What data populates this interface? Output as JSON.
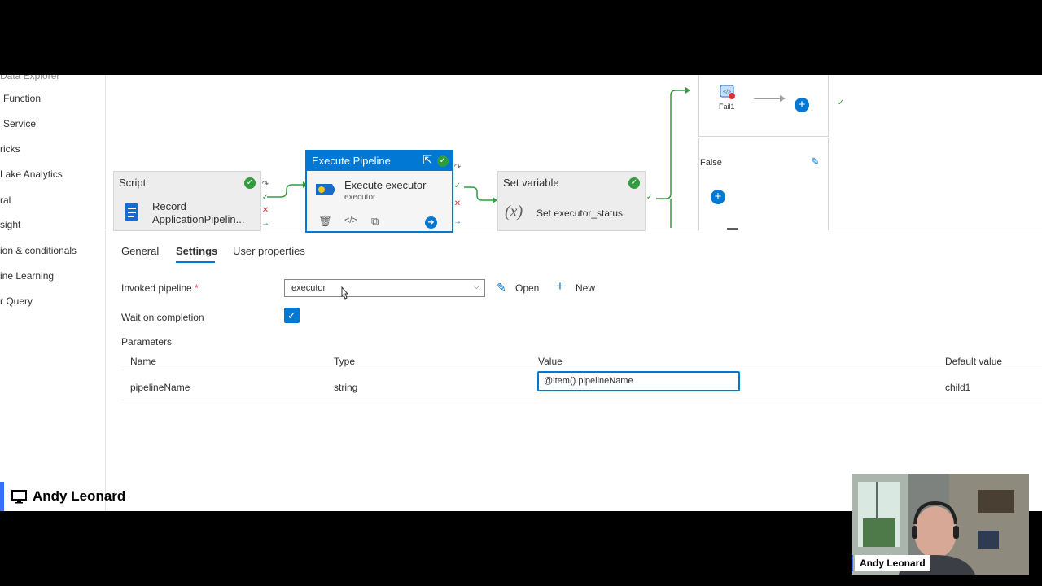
{
  "sidebar": {
    "items": [
      {
        "label": "Data Explorer"
      },
      {
        "label": "Function"
      },
      {
        "label": "Service"
      },
      {
        "label": "ricks"
      },
      {
        "label": "Lake Analytics"
      },
      {
        "label": "ral"
      },
      {
        "label": "sight"
      },
      {
        "label": "ion & conditionals"
      },
      {
        "label": "ine Learning"
      },
      {
        "label": "r Query"
      }
    ]
  },
  "canvas": {
    "script": {
      "header": "Script",
      "name_line1": "Record",
      "name_line2": "ApplicationPipelin..."
    },
    "execute_pipeline": {
      "header": "Execute Pipeline",
      "name": "Execute executor",
      "sub": "executor"
    },
    "set_variable": {
      "header": "Set variable",
      "symbol": "(x)",
      "name": "Set executor_status"
    },
    "fail": {
      "label": "Fail1"
    },
    "false_branch": {
      "label": "False"
    }
  },
  "tabs": [
    {
      "label": "General"
    },
    {
      "label": "Settings"
    },
    {
      "label": "User properties"
    }
  ],
  "settings": {
    "invoked_pipeline_label": "Invoked pipeline",
    "required_mark": "*",
    "invoked_pipeline_value": "executor",
    "open_label": "Open",
    "new_label": "New",
    "wait_label": "Wait on completion",
    "wait_checked": true,
    "parameters_label": "Parameters",
    "columns": [
      "Name",
      "Type",
      "Value",
      "Default value"
    ],
    "rows": [
      {
        "name": "pipelineName",
        "type": "string",
        "value": "@item().pipelineName",
        "default": "child1"
      }
    ]
  },
  "presenter": {
    "name": "Andy Leonard"
  },
  "webcam": {
    "name": "Andy Leonard"
  },
  "colors": {
    "accent": "#0078d4",
    "success": "#2e9e3d",
    "error": "#d13438"
  }
}
